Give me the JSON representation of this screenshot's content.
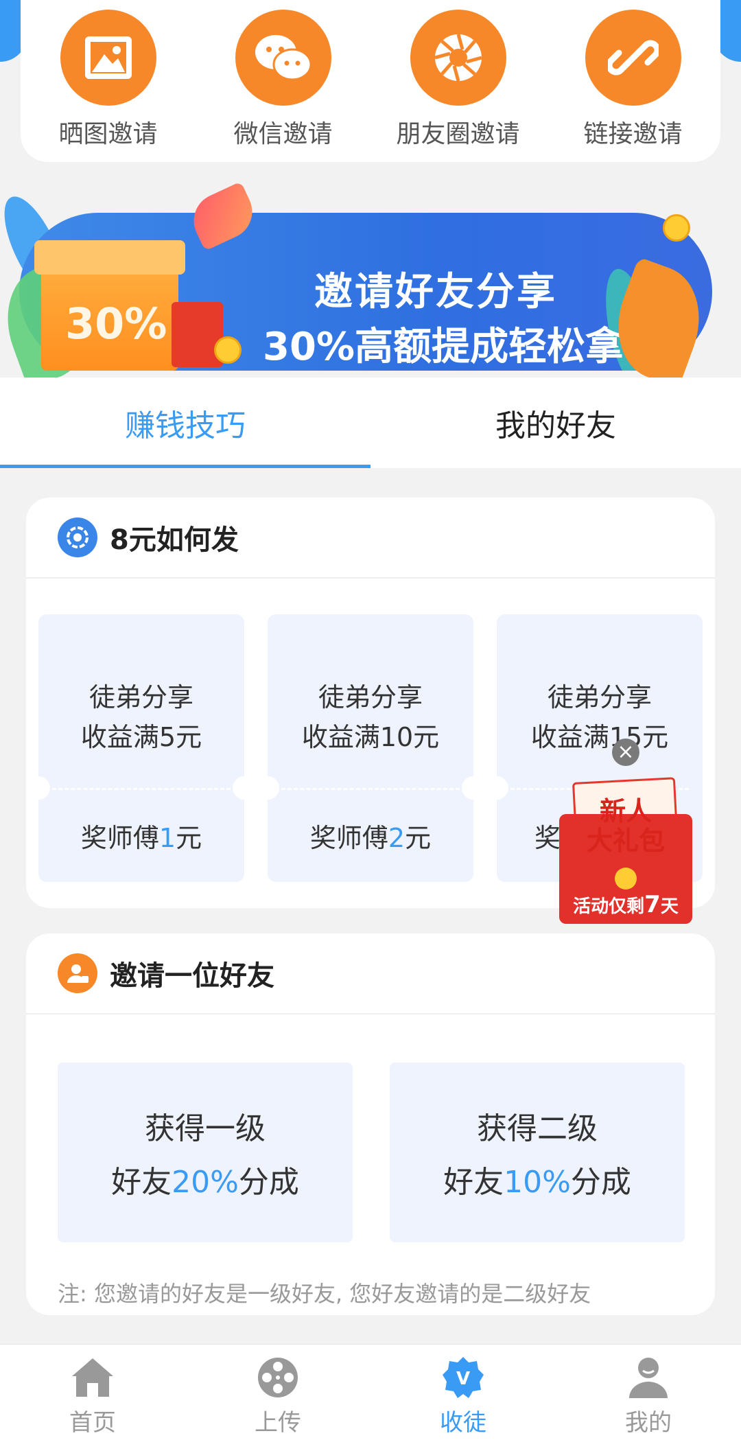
{
  "share_methods": [
    {
      "label": "晒图邀请",
      "icon": "image-icon"
    },
    {
      "label": "微信邀请",
      "icon": "wechat-icon"
    },
    {
      "label": "朋友圈邀请",
      "icon": "moments-icon"
    },
    {
      "label": "链接邀请",
      "icon": "link-icon"
    }
  ],
  "banner": {
    "line1": "邀请好友分享",
    "line2": "30%高额提成轻松拿",
    "gift_badge": "30%"
  },
  "tabs": [
    {
      "label": "赚钱技巧",
      "active": true
    },
    {
      "label": "我的好友",
      "active": false
    }
  ],
  "reward_section": {
    "title": "8元如何发",
    "items": [
      {
        "line1": "徒弟分享",
        "line2": "收益满5元",
        "prefix": "奖师傅",
        "amount": "1",
        "suffix": "元"
      },
      {
        "line1": "徒弟分享",
        "line2": "收益满10元",
        "prefix": "奖师傅",
        "amount": "2",
        "suffix": "元"
      },
      {
        "line1": "徒弟分享",
        "line2": "收益满15元",
        "prefix": "奖",
        "amount": "",
        "suffix": ""
      }
    ]
  },
  "invite_section": {
    "title": "邀请一位好友",
    "levels": [
      {
        "line1": "获得一级",
        "prefix": "好友",
        "pct": "20%",
        "suffix": "分成"
      },
      {
        "line1": "获得二级",
        "prefix": "好友",
        "pct": "10%",
        "suffix": "分成"
      }
    ],
    "note": "注: 您邀请的好友是一级好友, 您好友邀请的是二级好友"
  },
  "popup": {
    "line1": "新人",
    "line2": "大礼包",
    "footer_prefix": "活动仅剩",
    "footer_days": "7",
    "footer_suffix": "天",
    "close": "×"
  },
  "bottom_nav": [
    {
      "label": "首页",
      "icon": "home-icon",
      "active": false
    },
    {
      "label": "上传",
      "icon": "film-reel-icon",
      "active": false
    },
    {
      "label": "收徒",
      "icon": "vip-badge-icon",
      "active": true
    },
    {
      "label": "我的",
      "icon": "user-icon",
      "active": false
    }
  ],
  "colors": {
    "accent": "#3a9bf5",
    "orange": "#f7882a",
    "card_bg": "#eef3fd"
  }
}
